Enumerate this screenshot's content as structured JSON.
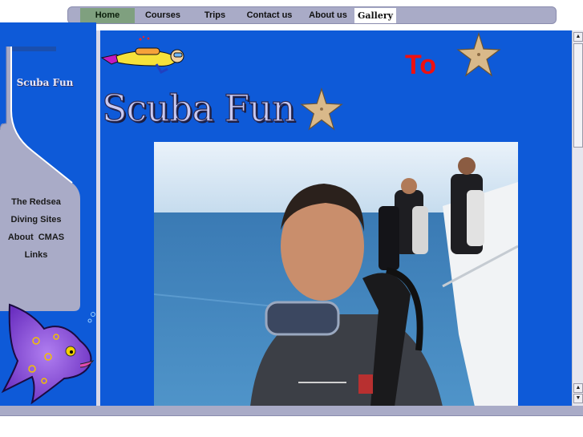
{
  "nav": {
    "home": "Home",
    "courses": "Courses",
    "trips": "Trips",
    "contact": "Contact us",
    "about": "About us",
    "gallery": "Gallery"
  },
  "sidebar": {
    "logo": "Scuba Fun",
    "links": [
      "The Redsea",
      "Diving Sites",
      "About  CMAS",
      "Links"
    ]
  },
  "main": {
    "to_text": "To",
    "title": "Scuba Fun"
  },
  "scrollbar": {
    "up_arrow": "▲",
    "down_arrow": "▼"
  },
  "colors": {
    "page_blue": "#0e5ad8",
    "nav_gray": "#a9abc7",
    "nav_active": "#7fa07f",
    "to_red": "#ef1010"
  },
  "icons": [
    "scuba-diver-icon",
    "starfish-icon",
    "fish-icon"
  ]
}
